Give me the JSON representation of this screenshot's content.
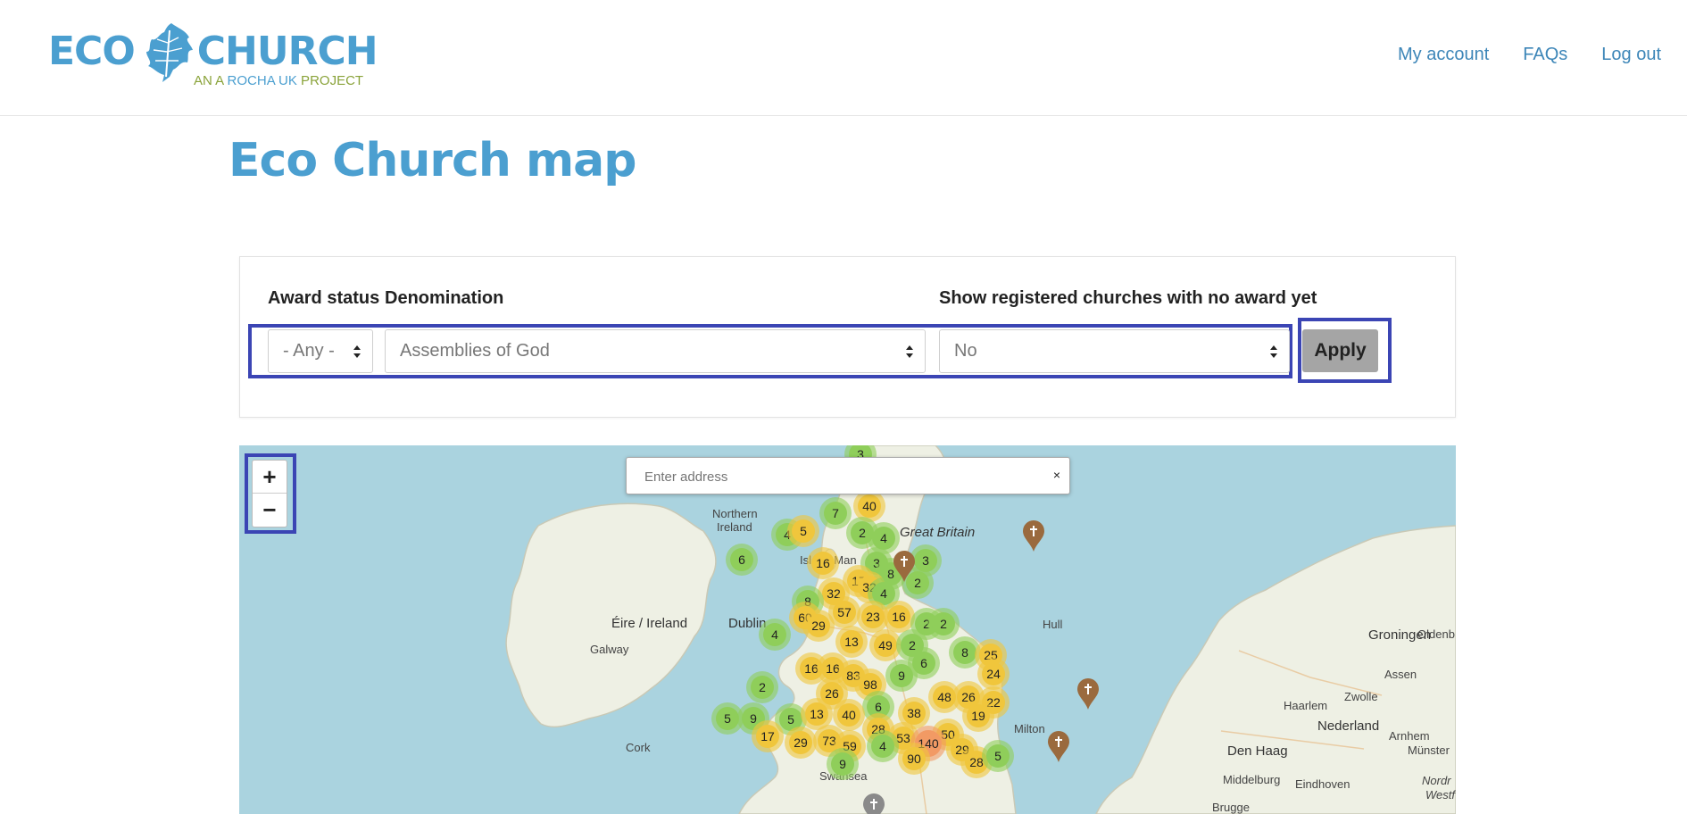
{
  "header": {
    "logo_main": "ECO CHURCH",
    "logo_word1": "ECO",
    "logo_word2": "CHURCH",
    "logo_sub_a": "AN A ",
    "logo_sub_b": "ROCHA UK",
    "logo_sub_c": " PROJECT",
    "nav": [
      {
        "label": "My account"
      },
      {
        "label": "FAQs"
      },
      {
        "label": "Log out"
      }
    ]
  },
  "page": {
    "title": "Eco Church map"
  },
  "filters": {
    "award_status_label": "Award status",
    "denomination_label": "Denomination",
    "show_registered_label": "Show registered churches with no award yet",
    "award_status_value": "- Any -",
    "denomination_value": "Assemblies of God",
    "show_registered_value": "No",
    "apply_label": "Apply"
  },
  "map": {
    "zoom_in": "+",
    "zoom_out": "−",
    "search_placeholder": "Enter address",
    "search_clear": "×",
    "colors": {
      "green": "#8fce5a",
      "yellow": "#f0c63c",
      "orange": "#f29a64",
      "water": "#aad3df",
      "land": "#eef0e4"
    },
    "labels": [
      {
        "text": "Northern"
      },
      {
        "text": "Ireland"
      },
      {
        "text": "Isle of Man"
      },
      {
        "text": "Éire / Ireland"
      },
      {
        "text": "Dublin"
      },
      {
        "text": "Galway"
      },
      {
        "text": "Cork"
      },
      {
        "text": "Great Britain"
      },
      {
        "text": "Hull"
      },
      {
        "text": "Groningen"
      },
      {
        "text": "Assen"
      },
      {
        "text": "Zwolle"
      },
      {
        "text": "Nederland"
      },
      {
        "text": "Den Haag"
      },
      {
        "text": "Haarlem"
      },
      {
        "text": "Middelburg"
      },
      {
        "text": "Eindhoven"
      },
      {
        "text": "Brugge"
      },
      {
        "text": "Münster"
      },
      {
        "text": "Arnhem"
      },
      {
        "text": "Swansea"
      },
      {
        "text": "Milton"
      },
      {
        "text": "Oldenb"
      },
      {
        "text": "Nordr"
      },
      {
        "text": "Westf"
      }
    ],
    "clusters": [
      {
        "count": "3",
        "color": "green"
      },
      {
        "count": "7",
        "color": "green"
      },
      {
        "count": "40",
        "color": "yellow"
      },
      {
        "count": "4",
        "color": "green"
      },
      {
        "count": "5",
        "color": "yellow"
      },
      {
        "count": "2",
        "color": "green"
      },
      {
        "count": "4",
        "color": "green"
      },
      {
        "count": "6",
        "color": "green"
      },
      {
        "count": "16",
        "color": "yellow"
      },
      {
        "count": "3",
        "color": "green"
      },
      {
        "count": "3",
        "color": "green"
      },
      {
        "count": "17",
        "color": "yellow"
      },
      {
        "count": "8",
        "color": "green"
      },
      {
        "count": "2",
        "color": "green"
      },
      {
        "count": "32",
        "color": "yellow"
      },
      {
        "count": "32",
        "color": "yellow"
      },
      {
        "count": "4",
        "color": "green"
      },
      {
        "count": "8",
        "color": "green"
      },
      {
        "count": "60",
        "color": "yellow"
      },
      {
        "count": "57",
        "color": "yellow"
      },
      {
        "count": "29",
        "color": "yellow"
      },
      {
        "count": "23",
        "color": "yellow"
      },
      {
        "count": "16",
        "color": "yellow"
      },
      {
        "count": "2",
        "color": "green"
      },
      {
        "count": "2",
        "color": "green"
      },
      {
        "count": "4",
        "color": "green"
      },
      {
        "count": "13",
        "color": "yellow"
      },
      {
        "count": "49",
        "color": "yellow"
      },
      {
        "count": "2",
        "color": "green"
      },
      {
        "count": "8",
        "color": "green"
      },
      {
        "count": "25",
        "color": "yellow"
      },
      {
        "count": "6",
        "color": "green"
      },
      {
        "count": "16",
        "color": "yellow"
      },
      {
        "count": "16",
        "color": "yellow"
      },
      {
        "count": "83",
        "color": "yellow"
      },
      {
        "count": "24",
        "color": "yellow"
      },
      {
        "count": "9",
        "color": "green"
      },
      {
        "count": "2",
        "color": "green"
      },
      {
        "count": "98",
        "color": "yellow"
      },
      {
        "count": "26",
        "color": "yellow"
      },
      {
        "count": "48",
        "color": "yellow"
      },
      {
        "count": "26",
        "color": "yellow"
      },
      {
        "count": "22",
        "color": "yellow"
      },
      {
        "count": "6",
        "color": "green"
      },
      {
        "count": "5",
        "color": "green"
      },
      {
        "count": "9",
        "color": "green"
      },
      {
        "count": "5",
        "color": "green"
      },
      {
        "count": "13",
        "color": "yellow"
      },
      {
        "count": "40",
        "color": "yellow"
      },
      {
        "count": "38",
        "color": "yellow"
      },
      {
        "count": "19",
        "color": "yellow"
      },
      {
        "count": "17",
        "color": "yellow"
      },
      {
        "count": "28",
        "color": "yellow"
      },
      {
        "count": "29",
        "color": "yellow"
      },
      {
        "count": "73",
        "color": "yellow"
      },
      {
        "count": "53",
        "color": "yellow"
      },
      {
        "count": "50",
        "color": "yellow"
      },
      {
        "count": "140",
        "color": "orange"
      },
      {
        "count": "59",
        "color": "yellow"
      },
      {
        "count": "4",
        "color": "green"
      },
      {
        "count": "29",
        "color": "yellow"
      },
      {
        "count": "90",
        "color": "yellow"
      },
      {
        "count": "28",
        "color": "yellow"
      },
      {
        "count": "5",
        "color": "green"
      },
      {
        "count": "9",
        "color": "green"
      }
    ]
  }
}
